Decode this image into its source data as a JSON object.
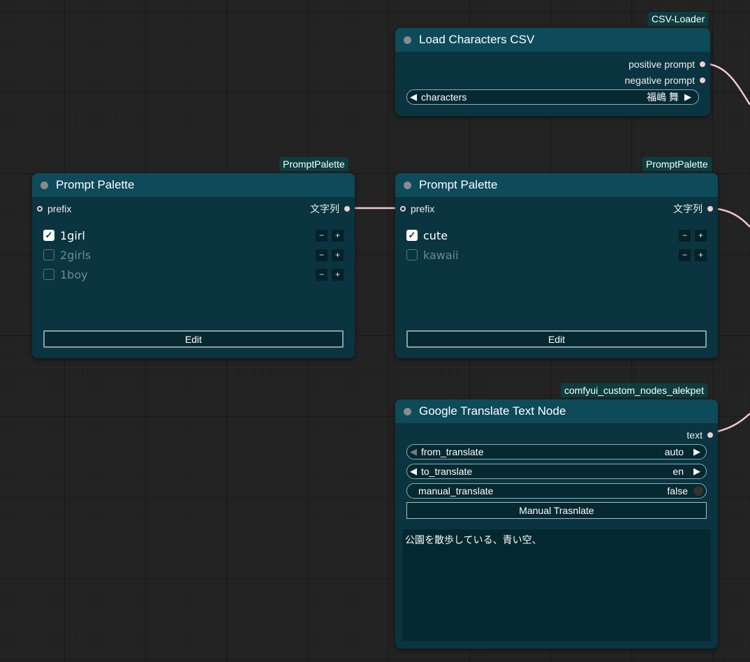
{
  "nodes": {
    "csv_loader": {
      "badge": "CSV-Loader",
      "title": "Load Characters CSV",
      "outputs": [
        "positive prompt",
        "negative prompt"
      ],
      "widget": {
        "label": "characters",
        "value": "福嶋 舞"
      }
    },
    "palette1": {
      "badge": "PromptPalette",
      "title": "Prompt Palette",
      "input": "prefix",
      "output": "文字列",
      "items": [
        {
          "label": "1girl",
          "checked": true
        },
        {
          "label": "2girls",
          "checked": false
        },
        {
          "label": "1boy",
          "checked": false
        }
      ],
      "edit_label": "Edit"
    },
    "palette2": {
      "badge": "PromptPalette",
      "title": "Prompt Palette",
      "input": "prefix",
      "output": "文字列",
      "items": [
        {
          "label": "cute",
          "checked": true
        },
        {
          "label": "kawaii",
          "checked": false
        }
      ],
      "edit_label": "Edit"
    },
    "translate": {
      "badge": "comfyui_custom_nodes_alekpet",
      "title": "Google Translate Text Node",
      "output": "text",
      "from": {
        "label": "from_translate",
        "value": "auto"
      },
      "to": {
        "label": "to_translate",
        "value": "en"
      },
      "manual": {
        "label": "manual_translate",
        "value": "false"
      },
      "button": "Manual Trasnlate",
      "text": "公園を散歩している、青い空、"
    }
  },
  "colors": {
    "link": "#f0c8c8",
    "node_body": "#0a3440",
    "node_header": "#0d4a5a"
  },
  "icons": {
    "checked": "✓",
    "minus": "−",
    "plus": "+",
    "left": "◀",
    "right": "▶"
  }
}
